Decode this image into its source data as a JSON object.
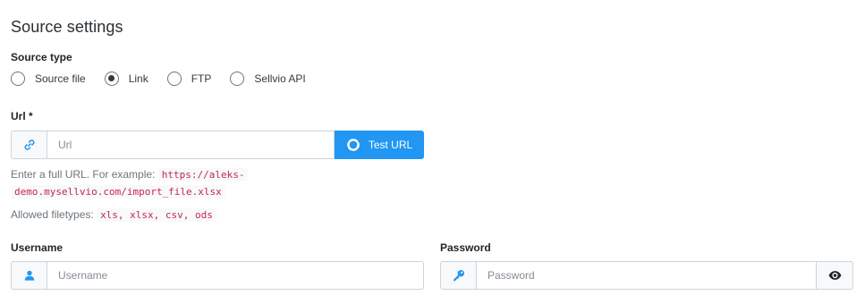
{
  "section": {
    "title": "Source settings"
  },
  "source_type": {
    "label": "Source type",
    "options": [
      {
        "label": "Source file",
        "checked": false
      },
      {
        "label": "Link",
        "checked": true
      },
      {
        "label": "FTP",
        "checked": false
      },
      {
        "label": "Sellvio API",
        "checked": false
      }
    ]
  },
  "url": {
    "label": "Url *",
    "placeholder": "Url",
    "value": "",
    "icon": "link-icon",
    "test_button_label": "Test URL",
    "help_prefix": "Enter a full URL. For example:",
    "example_line1": "https://aleks-",
    "example_line2": "demo.mysellvio.com/import_file.xlsx",
    "filetypes_prefix": "Allowed filetypes:",
    "filetypes": "xls, xlsx, csv, ods"
  },
  "username": {
    "label": "Username",
    "placeholder": "Username",
    "value": "",
    "icon": "user-icon"
  },
  "password": {
    "label": "Password",
    "placeholder": "Password",
    "value": "",
    "icon": "key-icon",
    "toggle_icon": "eye-icon"
  },
  "colors": {
    "accent": "#2196f3",
    "code": "#c7254e",
    "border": "#ced4da"
  }
}
